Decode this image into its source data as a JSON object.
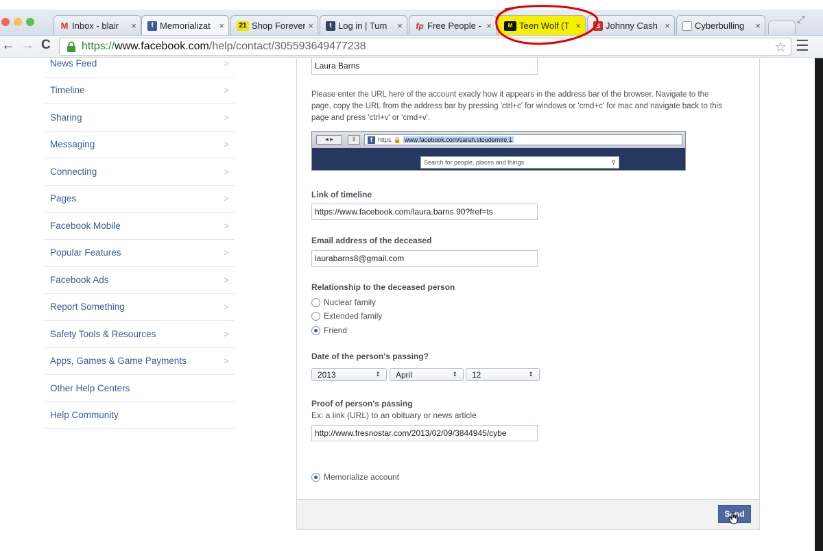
{
  "browser": {
    "tabs": [
      {
        "title": "Inbox - blair",
        "favicon": "gmail-icon"
      },
      {
        "title": "Memorializat",
        "favicon": "facebook-icon"
      },
      {
        "title": "Shop Forever",
        "favicon": "forever21-icon"
      },
      {
        "title": "Log in | Tum",
        "favicon": "tumblr-icon"
      },
      {
        "title": "Free People -",
        "favicon": "freepeople-icon"
      },
      {
        "title": "Teen Wolf (T",
        "favicon": "mtv-icon"
      },
      {
        "title": "Johnny Cash",
        "favicon": "news-icon"
      },
      {
        "title": "Cyberbulling",
        "favicon": "document-icon"
      }
    ],
    "close_glyph": "×",
    "url_secure": "https://",
    "url_host": "www.facebook.com",
    "url_path": "/help/contact/305593649477238"
  },
  "sidebar": {
    "items": [
      {
        "label": "News Feed",
        "chevron": true
      },
      {
        "label": "Timeline",
        "chevron": true
      },
      {
        "label": "Sharing",
        "chevron": true
      },
      {
        "label": "Messaging",
        "chevron": true
      },
      {
        "label": "Connecting",
        "chevron": true
      },
      {
        "label": "Pages",
        "chevron": true
      },
      {
        "label": "Facebook Mobile",
        "chevron": true
      },
      {
        "label": "Popular Features",
        "chevron": true
      },
      {
        "label": "Facebook Ads",
        "chevron": true
      },
      {
        "label": "Report Something",
        "chevron": true
      },
      {
        "label": "Safety Tools & Resources",
        "chevron": true
      },
      {
        "label": "Apps, Games & Game Payments",
        "chevron": true
      },
      {
        "label": "Other Help Centers",
        "chevron": false
      },
      {
        "label": "Help Community",
        "chevron": false
      }
    ]
  },
  "form": {
    "name_value": "Laura Barns",
    "url_instructions": "Please enter the URL here of the account exacly how it appears in the address bar of the browser. Navigate to the page, copy the URL from the address bar by pressing 'ctrl+c' for windows or 'cmd+c' for mac and navigate back to this page and press 'ctrl+v' or 'cmd+v'.",
    "example_https": "https",
    "example_url": "www.facebook.com/sarah.stoudemire.1",
    "example_search_placeholder": "Search for people, places and things",
    "timeline_label": "Link of timeline",
    "timeline_value": "https://www.facebook.com/laura.barns.90?fref=ts",
    "email_label": "Email address of the deceased",
    "email_value": "laurabarns8@gmail.com",
    "relationship_label": "Relationship to the deceased person",
    "relationship_options": [
      "Nuclear family",
      "Extended family",
      "Friend"
    ],
    "relationship_selected": "Friend",
    "date_label": "Date of the person's passing?",
    "date_year": "2013",
    "date_month": "April",
    "date_day": "12",
    "proof_label": "Proof of person's passing",
    "proof_hint": "Ex: a link (URL) to an obituary or news article",
    "proof_value": "http://www.fresnostar.com/2013/02/09/3844945/cybe",
    "memorialize_label": "Memorialize account",
    "send_label": "Send"
  },
  "colors": {
    "facebook_blue": "#3b5998",
    "annotation_red": "#e00000",
    "highlight_yellow": "#f5f000"
  }
}
